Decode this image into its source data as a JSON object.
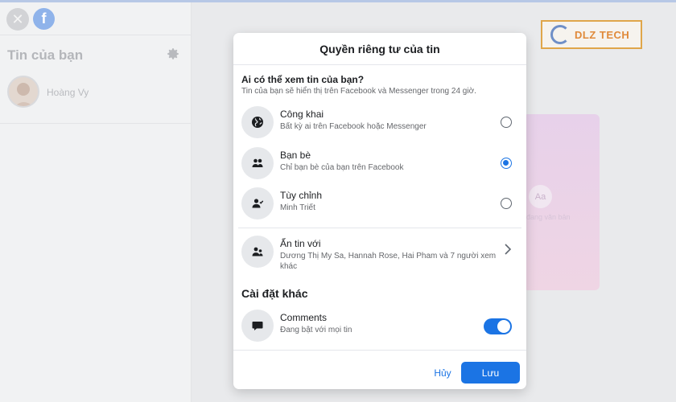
{
  "sidebar": {
    "title": "Tin của bạn",
    "user_name": "Hoàng Vy",
    "close_glyph": "✕",
    "logo_glyph": "f"
  },
  "brand": {
    "name": "DLZ TECH"
  },
  "background_card": {
    "aa": "Aa",
    "caption": "đang văn bản"
  },
  "modal": {
    "title": "Quyền riêng tư của tin",
    "question": "Ai có thể xem tin của bạn?",
    "question_sub": "Tin của bạn sẽ hiển thị trên Facebook và Messenger trong 24 giờ.",
    "options": [
      {
        "title": "Công khai",
        "subtitle": "Bất kỳ ai trên Facebook hoặc Messenger",
        "icon": "globe-icon",
        "selected": false
      },
      {
        "title": "Bạn bè",
        "subtitle": "Chỉ bạn bè của bạn trên Facebook",
        "icon": "friends-icon",
        "selected": true
      },
      {
        "title": "Tùy chỉnh",
        "subtitle": "Minh Triết",
        "icon": "custom-user-icon",
        "selected": false
      }
    ],
    "hide_story": {
      "title": "Ẩn tin với",
      "subtitle": "Dương Thị My Sa, Hannah Rose, Hai Pham và 7 người xem khác",
      "icon": "hide-users-icon"
    },
    "other_settings_title": "Cài đặt khác",
    "comments": {
      "title": "Comments",
      "subtitle": "Đang bật với mọi tin",
      "icon": "comment-icon",
      "enabled": true
    },
    "cancel_label": "Hủy",
    "save_label": "Lưu"
  },
  "colors": {
    "accent": "#1b74e4",
    "icon_bg": "#e6e8eb",
    "overlay": "#e9eaec"
  }
}
